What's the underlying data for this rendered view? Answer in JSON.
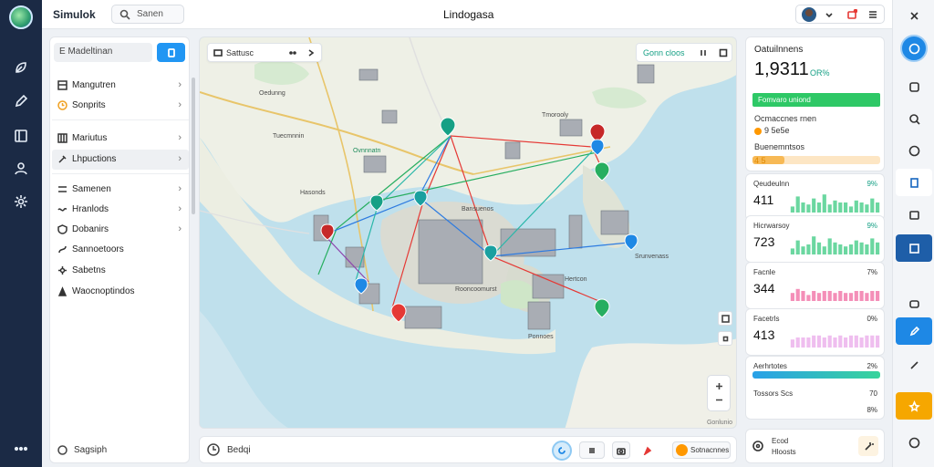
{
  "app": {
    "title": "Simulok",
    "page_title": "Lindogasa"
  },
  "search": {
    "label": "Sanen"
  },
  "left_panel": {
    "search_label": "E Madeltinan",
    "items": [
      {
        "label": "Mangutren",
        "icon": "layers-icon"
      },
      {
        "label": "Sonprits",
        "icon": "clock-icon"
      },
      {
        "label": "Mariutus",
        "icon": "grid-icon"
      },
      {
        "label": "Lhpuctions",
        "icon": "wrench-icon"
      },
      {
        "label": "Samenen",
        "icon": "grid-icon"
      },
      {
        "label": "Hranlods",
        "icon": "wave-icon"
      },
      {
        "label": "Dobanirs",
        "icon": "shield-icon"
      },
      {
        "label": "Sannoetoors",
        "icon": "route-icon"
      },
      {
        "label": "Sabetns",
        "icon": "gear-icon"
      },
      {
        "label": "Waocnoptindos",
        "icon": "pin-icon"
      }
    ],
    "bottom_label": "Sagsiph"
  },
  "map": {
    "toolbar_label": "Sattusc",
    "status_label": "Gonn cloos",
    "labels": [
      "Tuecmnnin",
      "Ovnnnatn",
      "Hasonds",
      "Bansuenos",
      "Oedunng",
      "Tmorooly",
      "Srunvenass",
      "Ponnoes",
      "Hertcon",
      "Rooncoomurst"
    ],
    "attribution": "Gonlunio"
  },
  "bottom_bar": {
    "label": "Bedqi",
    "status_label": "Sotnacnnes"
  },
  "summary": {
    "title": "Oatuilnnens",
    "value": "1,9311",
    "delta": "OR%",
    "bar_label": "Fomvaro uniond",
    "sub1": "Ocmaccnes rnen",
    "sub2": "9 5e5e",
    "sub3": "Buenemntsos",
    "progress_label": "4 5",
    "progress": 0.25
  },
  "metrics": [
    {
      "title": "Qeudeulnn",
      "percent": "9%",
      "value": "411",
      "color": "#39c980",
      "bars": [
        0.3,
        0.8,
        0.5,
        0.4,
        0.7,
        0.5,
        0.9,
        0.4,
        0.6,
        0.5,
        0.5,
        0.3,
        0.6,
        0.5,
        0.4,
        0.7,
        0.5
      ]
    },
    {
      "title": "Hicrwarsoy",
      "percent": "9%",
      "value": "723",
      "color": "#39c980",
      "bars": [
        0.3,
        0.7,
        0.4,
        0.5,
        0.9,
        0.6,
        0.4,
        0.8,
        0.6,
        0.5,
        0.4,
        0.5,
        0.7,
        0.6,
        0.5,
        0.8,
        0.6
      ]
    },
    {
      "title": "Facnle",
      "percent": "7%",
      "value": "344",
      "color": "#f06aa0",
      "bars": [
        0.4,
        0.6,
        0.5,
        0.3,
        0.5,
        0.4,
        0.5,
        0.5,
        0.4,
        0.5,
        0.4,
        0.4,
        0.5,
        0.5,
        0.4,
        0.5,
        0.5
      ]
    },
    {
      "title": "Facetrls",
      "percent": "0%",
      "value": "413",
      "color": "#e9a8ea",
      "bars": [
        0.4,
        0.5,
        0.5,
        0.5,
        0.6,
        0.6,
        0.5,
        0.6,
        0.5,
        0.6,
        0.5,
        0.6,
        0.6,
        0.5,
        0.6,
        0.6,
        0.6
      ]
    }
  ],
  "flow": {
    "title": "Aerhrtotes",
    "percent": "2%",
    "foot": "Tossors Scs",
    "foot_right": "70",
    "foot_right2": "8%"
  },
  "assistant": {
    "line1": "Ecod",
    "line2": "Hloosts"
  },
  "colors": {
    "accent": "#2196f3",
    "success": "#2ec866",
    "warning": "#ff9800",
    "sidebar": "#1b2a45"
  }
}
